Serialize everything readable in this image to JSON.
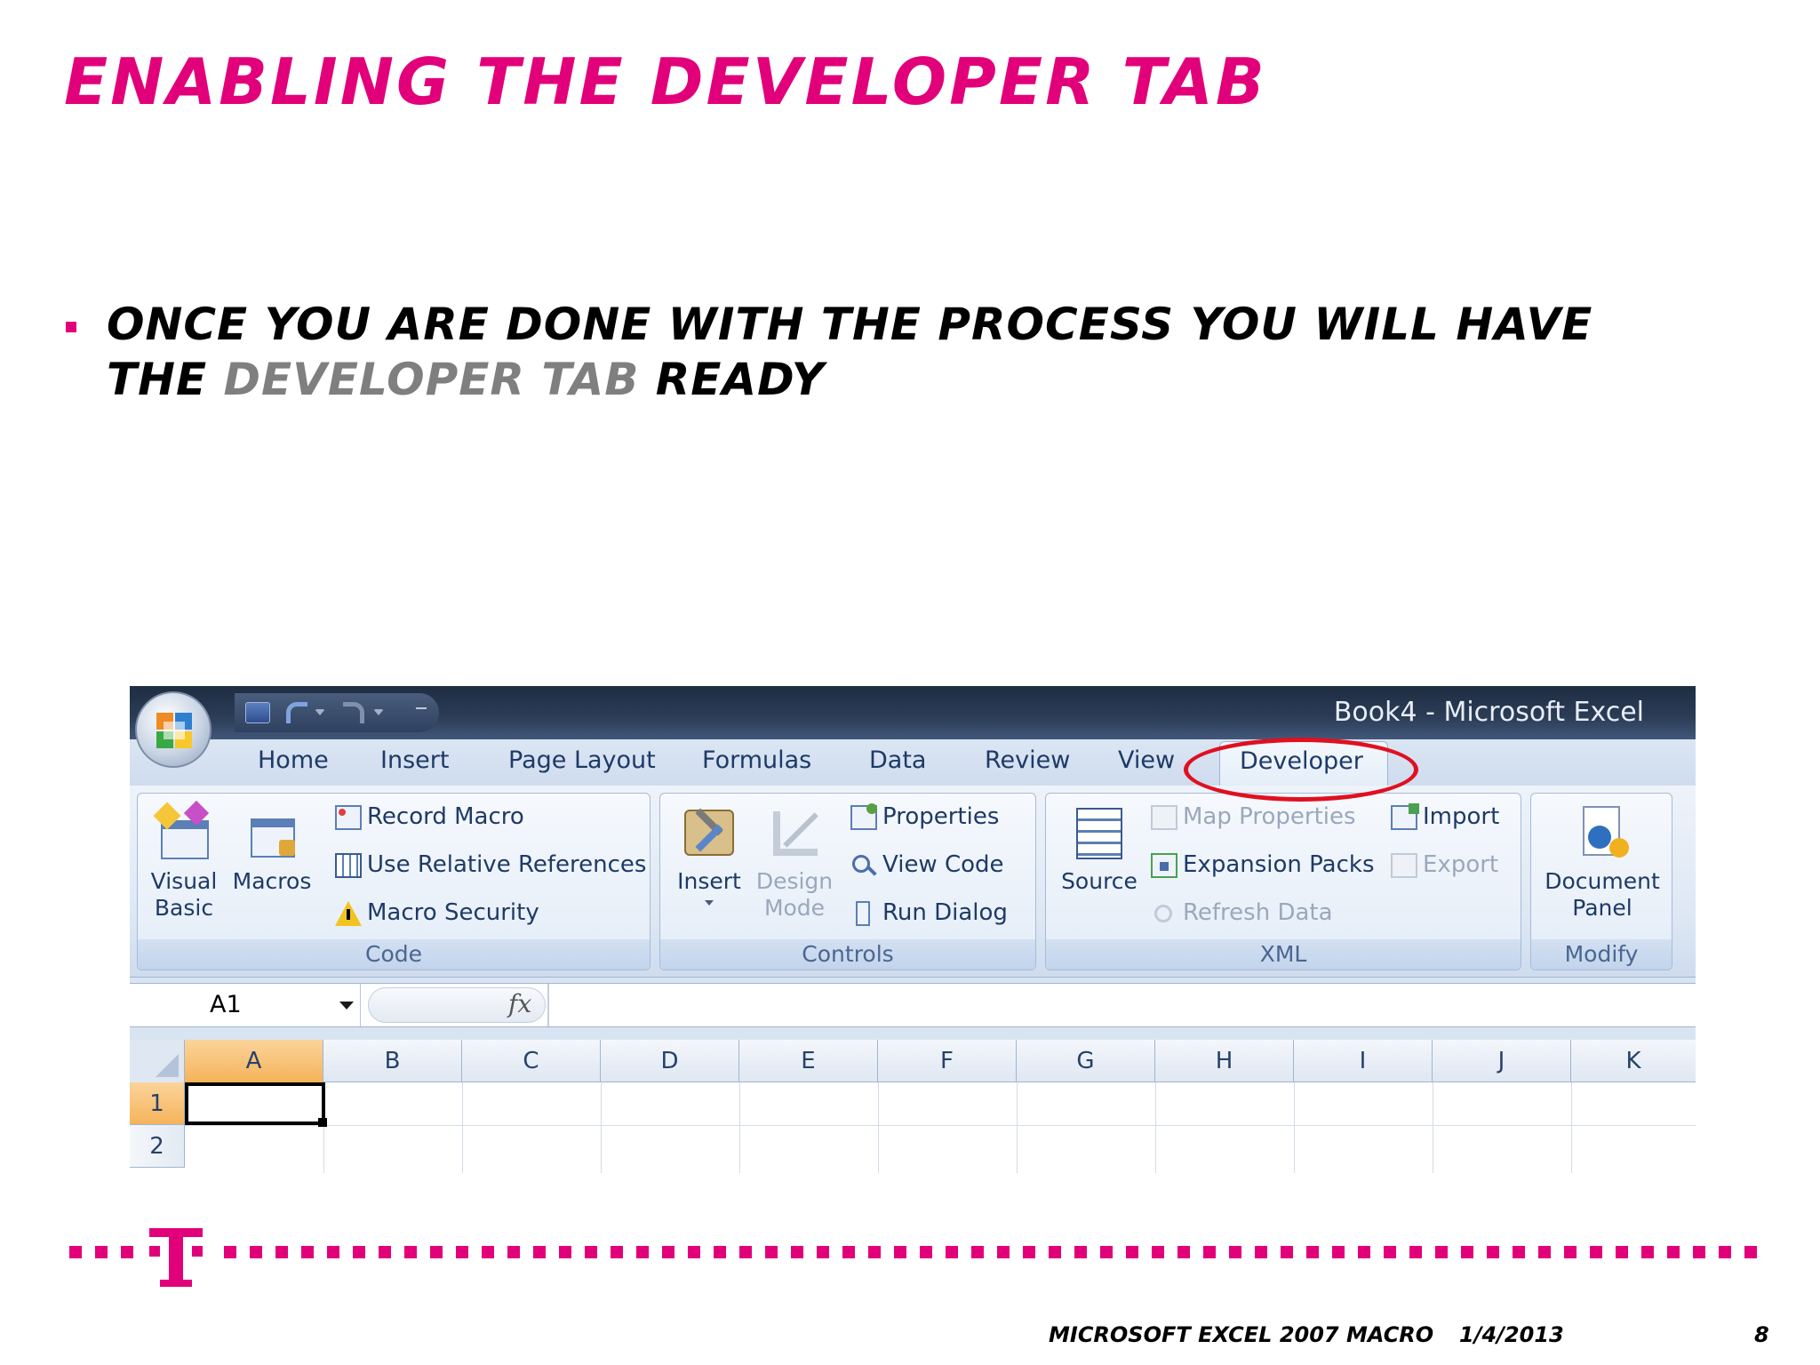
{
  "slide": {
    "title": "Enabling the Developer Tab",
    "bullet_part1": "Once you are done with the process you will have the ",
    "bullet_highlight": "Developer Tab",
    "bullet_part2": " ready"
  },
  "excel": {
    "window_title": "Book4 - Microsoft Excel",
    "tabs": [
      "Home",
      "Insert",
      "Page Layout",
      "Formulas",
      "Data",
      "Review",
      "View"
    ],
    "active_tab": "Developer",
    "groups": {
      "code": {
        "label": "Code",
        "visual_basic_line1": "Visual",
        "visual_basic_line2": "Basic",
        "macros": "Macros",
        "record_macro": "Record Macro",
        "use_relative": "Use Relative References",
        "macro_security": "Macro Security"
      },
      "controls": {
        "label": "Controls",
        "insert": "Insert",
        "design_line1": "Design",
        "design_line2": "Mode",
        "properties": "Properties",
        "view_code": "View Code",
        "run_dialog": "Run Dialog"
      },
      "xml": {
        "label": "XML",
        "source": "Source",
        "map_properties": "Map Properties",
        "expansion_packs": "Expansion Packs",
        "refresh_data": "Refresh Data",
        "import": "Import",
        "export": "Export"
      },
      "modify": {
        "label": "Modify",
        "document_line1": "Document",
        "document_line2": "Panel"
      }
    },
    "name_box": "A1",
    "fx": "fx",
    "columns": [
      "A",
      "B",
      "C",
      "D",
      "E",
      "F",
      "G",
      "H",
      "I",
      "J",
      "K"
    ],
    "rows": [
      "1",
      "2"
    ]
  },
  "footer": {
    "course": "Microsoft Excel 2007 Macro",
    "date": "1/4/2013",
    "page": "8"
  },
  "colors": {
    "accent": "#e2007a",
    "highlight_circle": "#e01020"
  }
}
